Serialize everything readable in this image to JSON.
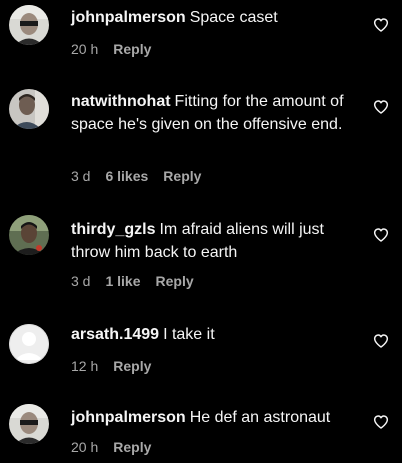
{
  "comments": [
    {
      "username": "johnpalmerson",
      "text": "Space caset",
      "time": "20 h",
      "likes": "",
      "reply": "Reply",
      "avatar": "avatar-man-sunglasses"
    },
    {
      "username": "natwithnohat",
      "text": "Fitting for the amount of space he's given on the offensive end.",
      "time": "3 d",
      "likes": "6 likes",
      "reply": "Reply",
      "avatar": "avatar-person-portrait"
    },
    {
      "username": "thirdy_gzls",
      "text": "Im afraid aliens will just throw him back to earth",
      "time": "3 d",
      "likes": "1 like",
      "reply": "Reply",
      "avatar": "avatar-person-green"
    },
    {
      "username": "arsath.1499",
      "text": "I take it",
      "time": "12 h",
      "likes": "",
      "reply": "Reply",
      "avatar": "avatar-default"
    },
    {
      "username": "johnpalmerson",
      "text": "He def an astronaut",
      "time": "20 h",
      "likes": "",
      "reply": "Reply",
      "avatar": "avatar-man-sunglasses"
    }
  ],
  "icons": {
    "like": "heart-outline-icon"
  },
  "colors": {
    "background": "#000000",
    "text": "#f5f5f5",
    "secondary": "#a8a8a8"
  }
}
